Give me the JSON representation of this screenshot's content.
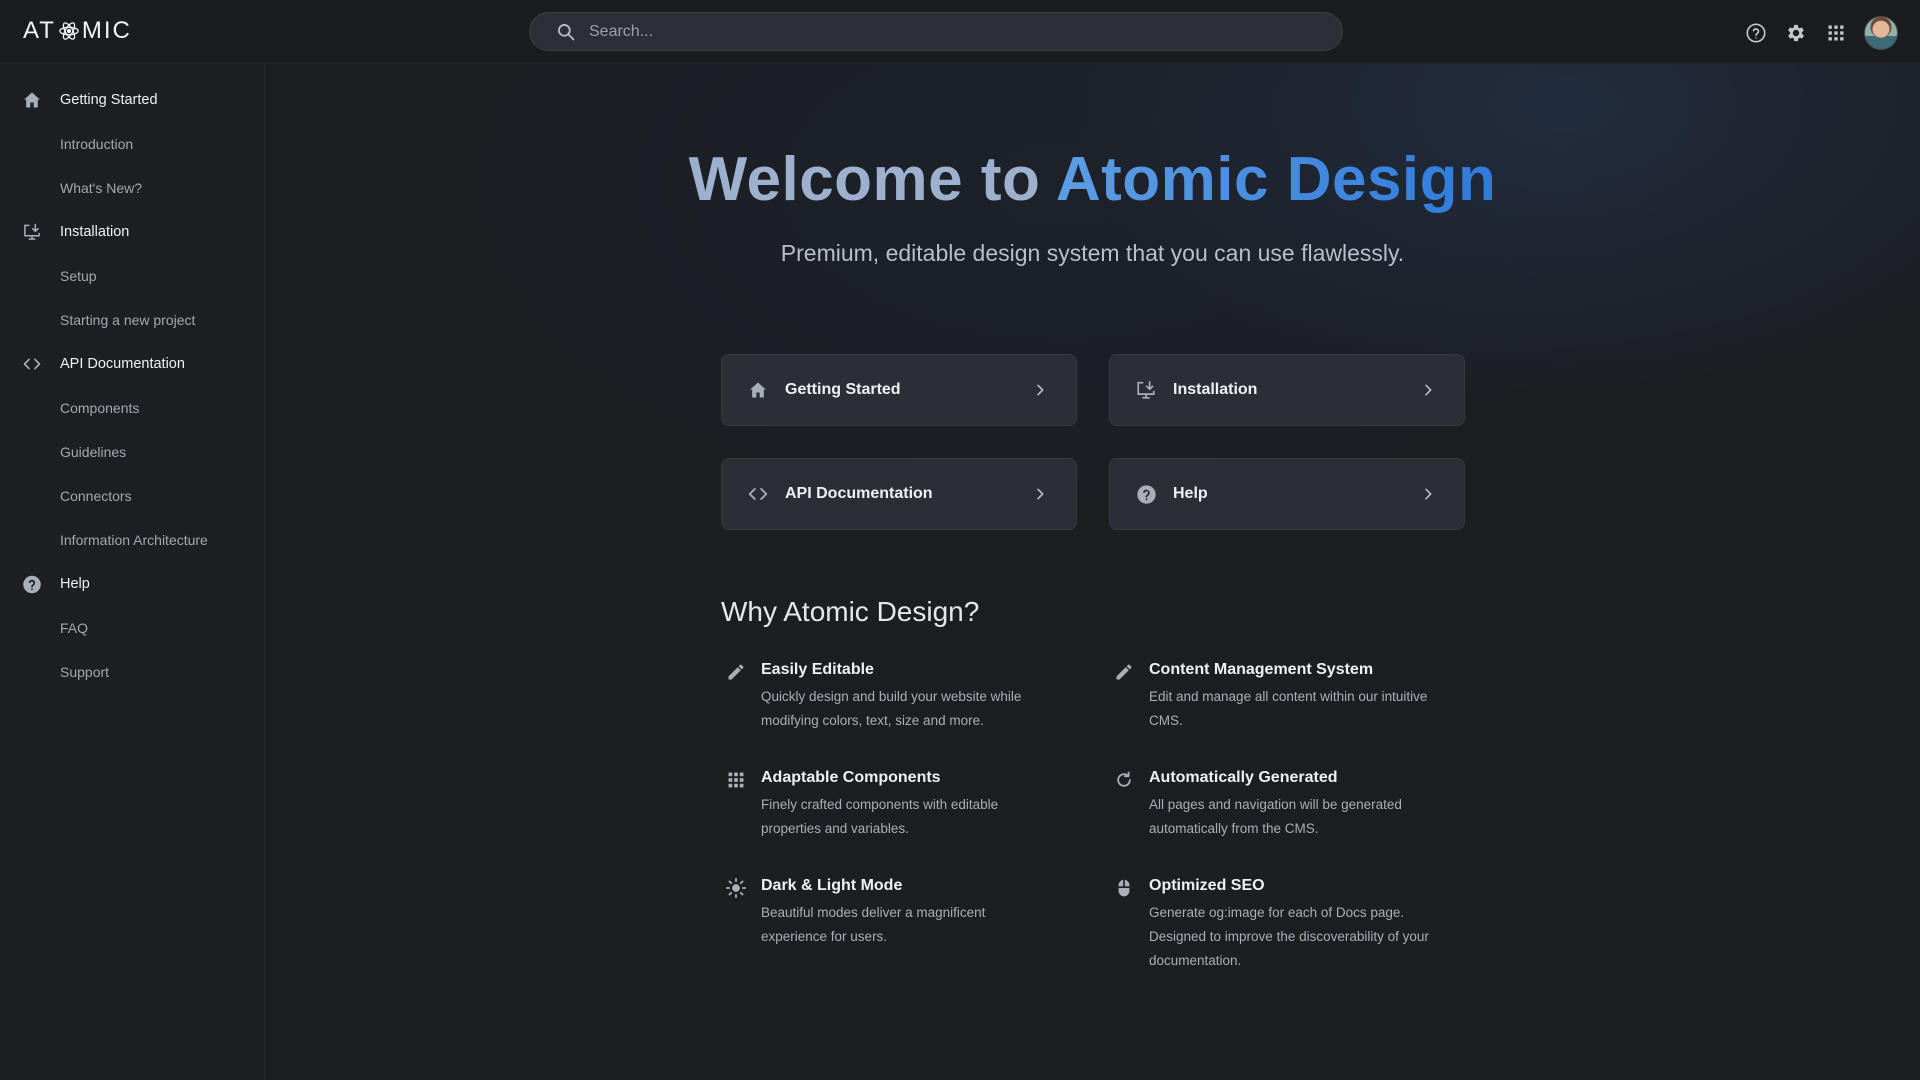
{
  "header": {
    "logo_left": "AT",
    "logo_right": "MIC",
    "search_placeholder": "Search..."
  },
  "sidebar": {
    "groups": [
      {
        "label": "Getting Started",
        "icon": "home-icon",
        "items": [
          "Introduction",
          "What's New?"
        ]
      },
      {
        "label": "Installation",
        "icon": "install-icon",
        "items": [
          "Setup",
          "Starting a new project"
        ]
      },
      {
        "label": "API Documentation",
        "icon": "code-icon",
        "items": [
          "Components",
          "Guidelines",
          "Connectors",
          "Information Architecture"
        ]
      },
      {
        "label": "Help",
        "icon": "help-icon",
        "items": [
          "FAQ",
          "Support"
        ]
      }
    ]
  },
  "hero": {
    "title_part1": "Welcome to",
    "title_part2": "Atomic Design",
    "subtitle": "Premium, editable design system that you can use flawlessly."
  },
  "cards": [
    {
      "label": "Getting Started",
      "icon": "home-icon"
    },
    {
      "label": "Installation",
      "icon": "install-icon"
    },
    {
      "label": "API Documentation",
      "icon": "code-icon"
    },
    {
      "label": "Help",
      "icon": "help-icon"
    }
  ],
  "why": {
    "title": "Why Atomic Design?",
    "features": [
      {
        "title": "Easily Editable",
        "desc": [
          "Quickly design and build your website while",
          "modifying colors, text, size and more."
        ],
        "icon": "pencil-icon"
      },
      {
        "title": "Content Management System",
        "desc": [
          "Edit and manage all content within our intuitive",
          "CMS."
        ],
        "icon": "pencil-icon"
      },
      {
        "title": "Adaptable Components",
        "desc": [
          "Finely crafted components with editable",
          "properties and variables."
        ],
        "icon": "grid-icon"
      },
      {
        "title": "Automatically Generated",
        "desc": [
          "All pages and navigation will be generated",
          "automatically from the CMS."
        ],
        "icon": "refresh-icon"
      },
      {
        "title": "Dark & Light Mode",
        "desc": [
          "Beautiful modes deliver a magnificent",
          "experience for users."
        ],
        "icon": "sun-icon"
      },
      {
        "title": "Optimized SEO",
        "desc": [
          "Generate og:image for each of Docs page.",
          "Designed to improve the discoverability of your",
          "documentation."
        ],
        "icon": "mouse-icon"
      }
    ]
  },
  "colors": {
    "background": "#1b1d20",
    "sidebar": "#1d1f23",
    "card": "#2b2f35",
    "accent": "#2f7bdc",
    "title_light": "#9db1cf"
  }
}
